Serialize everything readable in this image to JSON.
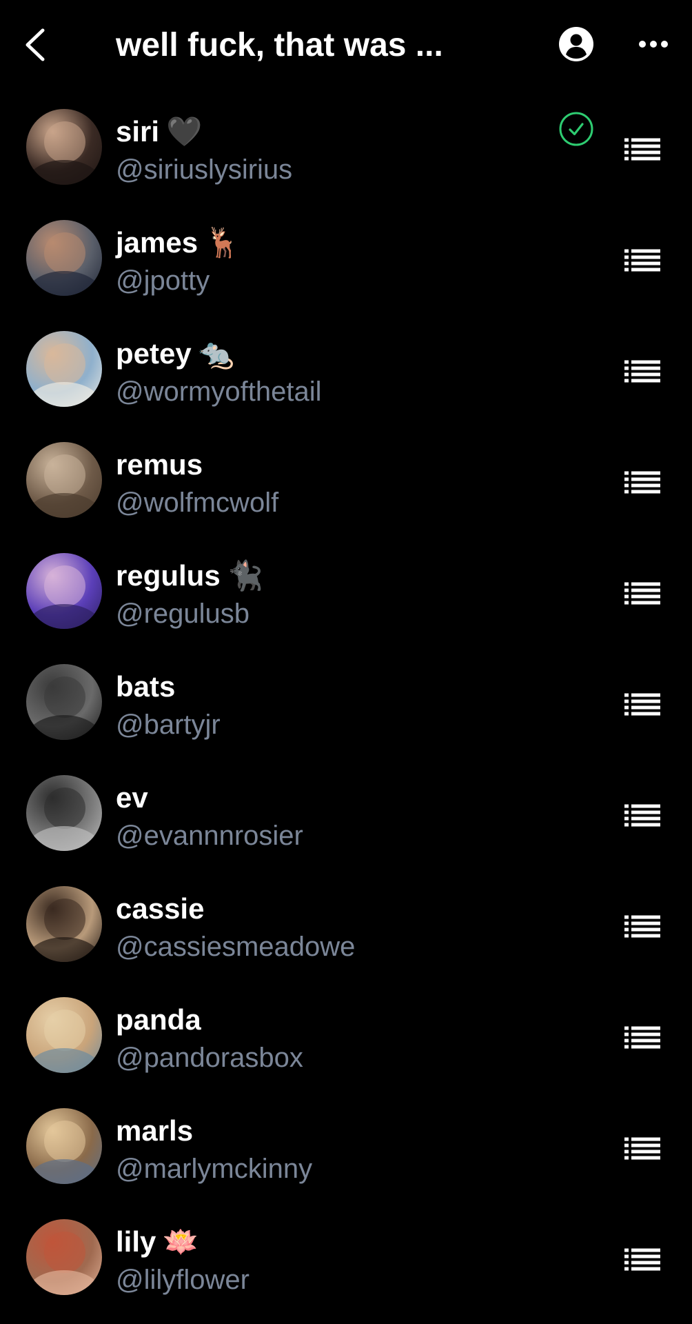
{
  "header": {
    "title": "well fuck, that was ...",
    "back_icon": "chevron-left-icon",
    "profile_icon": "person-circle-icon",
    "more_icon": "ellipsis-icon"
  },
  "colors": {
    "background": "#000000",
    "text_primary": "#ffffff",
    "text_secondary": "#7b8698",
    "check_green": "#2ecc71"
  },
  "members": [
    {
      "name": "siri",
      "emoji": "🖤",
      "handle": "@siriuslysirius",
      "selected": true,
      "avatar_colors": [
        "#3a2a24",
        "#c9a48a",
        "#1c1412"
      ]
    },
    {
      "name": "james",
      "emoji": "🦌",
      "handle": "@jpotty",
      "selected": false,
      "avatar_colors": [
        "#5a5f6a",
        "#b88a70",
        "#1d2435"
      ]
    },
    {
      "name": "petey",
      "emoji": "🐀",
      "handle": "@wormyofthetail",
      "selected": false,
      "avatar_colors": [
        "#8fb0cc",
        "#d9b89a",
        "#f0ece4"
      ]
    },
    {
      "name": "remus",
      "emoji": "",
      "handle": "@wolfmcwolf",
      "selected": false,
      "avatar_colors": [
        "#6e5a48",
        "#c9b39a",
        "#4a3a2c"
      ]
    },
    {
      "name": "regulus",
      "emoji": "🐈‍⬛",
      "handle": "@regulusb",
      "selected": false,
      "avatar_colors": [
        "#5b3fb8",
        "#d7b2d8",
        "#2b1f5e"
      ]
    },
    {
      "name": "bats",
      "emoji": "",
      "handle": "@bartyjr",
      "selected": false,
      "avatar_colors": [
        "#6a6a6a",
        "#3a3a3a",
        "#1a1a1a"
      ]
    },
    {
      "name": "ev",
      "emoji": "",
      "handle": "@evannnrosier",
      "selected": false,
      "avatar_colors": [
        "#7a7a7a",
        "#2d2d2d",
        "#bfbfbf"
      ]
    },
    {
      "name": "cassie",
      "emoji": "",
      "handle": "@cassiesmeadowe",
      "selected": false,
      "avatar_colors": [
        "#b89a7a",
        "#3a2a20",
        "#1c1410"
      ]
    },
    {
      "name": "panda",
      "emoji": "",
      "handle": "@pandorasbox",
      "selected": false,
      "avatar_colors": [
        "#c9a47a",
        "#e6cfa8",
        "#6a8aa0"
      ]
    },
    {
      "name": "marls",
      "emoji": "",
      "handle": "@marlymckinny",
      "selected": false,
      "avatar_colors": [
        "#8a6a4a",
        "#e3c79a",
        "#5a6e8a"
      ]
    },
    {
      "name": "lily",
      "emoji": "🪷",
      "handle": "@lilyflower",
      "selected": false,
      "avatar_colors": [
        "#a06a50",
        "#c0553a",
        "#e3b49a"
      ]
    }
  ],
  "row_icons": {
    "reorder_icon": "drag-handle-icon",
    "check_icon": "check-circle-icon"
  }
}
